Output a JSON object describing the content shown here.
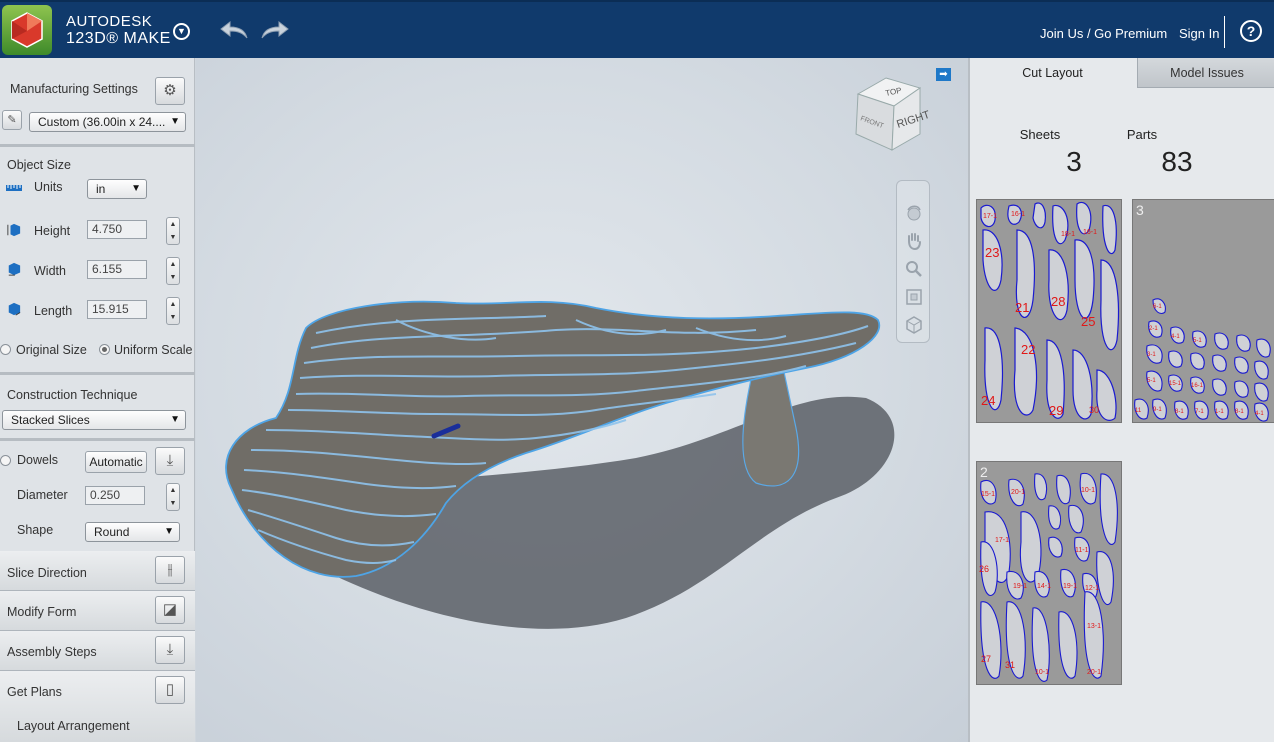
{
  "header": {
    "brand_line1": "AUTODESK",
    "brand_line2": "123D® MAKE",
    "join_label": "Join Us / Go Premium",
    "signin_label": "Sign In",
    "help_label": "?"
  },
  "left": {
    "manufacturing_settings": "Manufacturing Settings",
    "material_preset": "Custom (36.00in x 24....",
    "object_size": "Object Size",
    "units_label": "Units",
    "units_value": "in",
    "height_label": "Height",
    "height_value": "4.750",
    "width_label": "Width",
    "width_value": "6.155",
    "length_label": "Length",
    "length_value": "15.915",
    "original_size": "Original Size",
    "uniform_scale": "Uniform Scale",
    "construction_technique": "Construction Technique",
    "technique_value": "Stacked Slices",
    "dowels_label": "Dowels",
    "dowels_button": "Automatic",
    "diameter_label": "Diameter",
    "diameter_value": "0.250",
    "shape_label": "Shape",
    "shape_value": "Round",
    "slice_direction": "Slice Direction",
    "modify_form": "Modify Form",
    "assembly_steps": "Assembly Steps",
    "get_plans": "Get Plans",
    "layout_arrangement": "Layout Arrangement"
  },
  "viewcube": {
    "top": "TOP",
    "right": "RIGHT",
    "front": "FRONT"
  },
  "right": {
    "tab_cut_layout": "Cut Layout",
    "tab_model_issues": "Model Issues",
    "sheets_label": "Sheets",
    "sheets_value": "3",
    "parts_label": "Parts",
    "parts_value": "83",
    "sheet3_label": "3",
    "sheet2_label": "2"
  },
  "colors": {
    "header_bg": "#103a6c",
    "accent_blue": "#1e78c8",
    "part_outline": "#1a1ad0",
    "part_label": "#e01818"
  }
}
